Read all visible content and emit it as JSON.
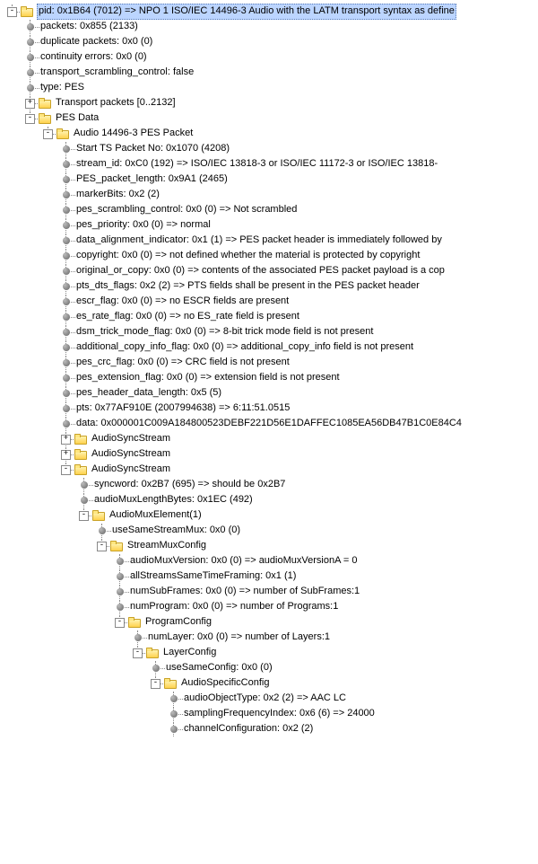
{
  "root": {
    "pid_label": "pid: 0x1B64 (7012) => NPO 1 ISO/IEC 14496-3 Audio with the LATM transport syntax as define"
  },
  "pid_props": {
    "packets": "packets: 0x855 (2133)",
    "duplicate_packets": "duplicate packets: 0x0 (0)",
    "continuity_errors": "continuity errors: 0x0 (0)",
    "tsc": "transport_scrambling_control: false",
    "type": "type: PES"
  },
  "transport_packets": "Transport packets [0..2132]",
  "pes_data": "PES Data",
  "pes_packet": "Audio 14496-3 PES Packet",
  "pes_fields": {
    "start_ts": "Start TS Packet No: 0x1070 (4208)",
    "stream_id": "stream_id: 0xC0 (192) => ISO/IEC 13818-3 or ISO/IEC 11172-3 or ISO/IEC 13818-",
    "pes_packet_length": "PES_packet_length: 0x9A1 (2465)",
    "marker_bits": "markerBits: 0x2 (2)",
    "pes_scrambling": "pes_scrambling_control: 0x0 (0) => Not scrambled",
    "pes_priority": "pes_priority: 0x0 (0) => normal",
    "data_alignment": "data_alignment_indicator: 0x1 (1) => PES packet header is immediately followed by",
    "copyright": "copyright: 0x0 (0) => not defined whether the material is protected by copyright",
    "original_or_copy": "original_or_copy: 0x0 (0) => contents of the associated PES packet payload is a cop",
    "pts_dts_flags": "pts_dts_flags: 0x2 (2) => PTS fields shall be present in the PES packet header",
    "escr_flag": "escr_flag: 0x0 (0) => no ESCR fields are present",
    "es_rate_flag": "es_rate_flag: 0x0 (0) => no ES_rate field is present",
    "dsm_trick": "dsm_trick_mode_flag: 0x0 (0) => 8-bit trick mode field is not present",
    "additional_copy": "additional_copy_info_flag: 0x0 (0) => additional_copy_info field is not present",
    "pes_crc": "pes_crc_flag: 0x0 (0) => CRC field is not present",
    "pes_extension": "pes_extension_flag: 0x0 (0) => extension field is not present",
    "pes_header_len": "pes_header_data_length: 0x5 (5)",
    "pts": "pts: 0x77AF910E (2007994638) => 6:11:51.0515",
    "data": "data: 0x000001C009A184800523DEBF221D56E1DAFFEC1085EA56DB47B1C0E84C4"
  },
  "audio_sync_1": "AudioSyncStream",
  "audio_sync_2": "AudioSyncStream",
  "audio_sync_3": "AudioSyncStream",
  "sync_fields": {
    "syncword": "syncword: 0x2B7 (695) => should be 0x2B7",
    "audio_mux_len": "audioMuxLengthBytes: 0x1EC (492)"
  },
  "audio_mux_element": "AudioMuxElement(1)",
  "use_same_stream_mux": "useSameStreamMux: 0x0 (0)",
  "stream_mux_config": "StreamMuxConfig",
  "smc_fields": {
    "audio_mux_version": "audioMuxVersion: 0x0 (0) => audioMuxVersionA = 0",
    "all_streams": "allStreamsSameTimeFraming: 0x1 (1)",
    "num_sub_frames": "numSubFrames: 0x0 (0) => number of SubFrames:1",
    "num_program": "numProgram: 0x0 (0) => number of Programs:1"
  },
  "program_config": "ProgramConfig",
  "num_layer": "numLayer: 0x0 (0) => number of Layers:1",
  "layer_config": "LayerConfig",
  "use_same_config": "useSameConfig: 0x0 (0)",
  "audio_specific_config": "AudioSpecificConfig",
  "asc_fields": {
    "audio_object_type": "audioObjectType: 0x2 (2) => AAC LC",
    "sampling_freq": "samplingFrequencyIndex: 0x6 (6) => 24000",
    "channel_config": "channelConfiguration: 0x2 (2)"
  },
  "glyphs": {
    "plus": "+",
    "minus": "-"
  }
}
